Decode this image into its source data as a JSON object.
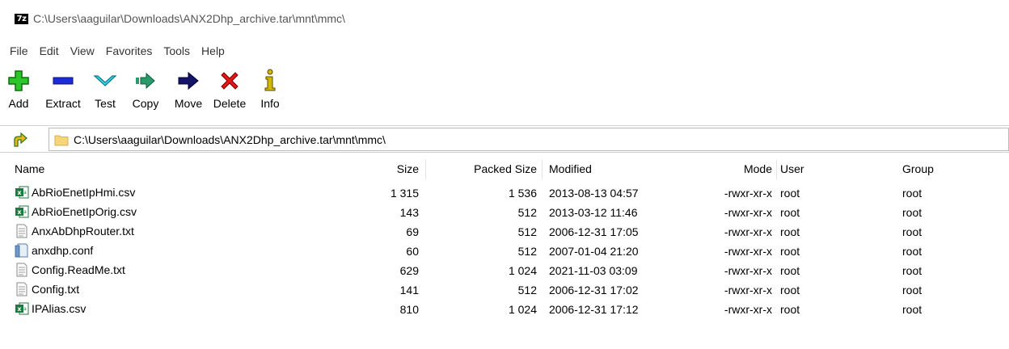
{
  "window": {
    "title": "C:\\Users\\aaguilar\\Downloads\\ANX2Dhp_archive.tar\\mnt\\mmc\\",
    "app_logo": "7z"
  },
  "menu": [
    "File",
    "Edit",
    "View",
    "Favorites",
    "Tools",
    "Help"
  ],
  "toolbar": [
    {
      "label": "Add",
      "icon": "add-icon",
      "color": "#22aa22"
    },
    {
      "label": "Extract",
      "icon": "extract-icon",
      "color": "#1c2bd6"
    },
    {
      "label": "Test",
      "icon": "test-icon",
      "color": "#22c2d6"
    },
    {
      "label": "Copy",
      "icon": "copy-icon",
      "color": "#2a9a6a"
    },
    {
      "label": "Move",
      "icon": "move-icon",
      "color": "#14146a"
    },
    {
      "label": "Delete",
      "icon": "delete-icon",
      "color": "#e01818"
    },
    {
      "label": "Info",
      "icon": "info-icon",
      "color": "#b49a00"
    }
  ],
  "address": {
    "path": "C:\\Users\\aaguilar\\Downloads\\ANX2Dhp_archive.tar\\mnt\\mmc\\"
  },
  "columns": {
    "name": "Name",
    "size": "Size",
    "packed": "Packed Size",
    "modified": "Modified",
    "mode": "Mode",
    "user": "User",
    "group": "Group"
  },
  "files": [
    {
      "name": "AbRioEnetIpHmi.csv",
      "icon": "excel-csv-icon",
      "size": "1 315",
      "packed": "1 536",
      "modified": "2013-08-13 04:57",
      "mode": "-rwxr-xr-x",
      "user": "root",
      "group": "root"
    },
    {
      "name": "AbRioEnetIpOrig.csv",
      "icon": "excel-csv-icon",
      "size": "143",
      "packed": "512",
      "modified": "2013-03-12 11:46",
      "mode": "-rwxr-xr-x",
      "user": "root",
      "group": "root"
    },
    {
      "name": "AnxAbDhpRouter.txt",
      "icon": "text-file-icon",
      "size": "69",
      "packed": "512",
      "modified": "2006-12-31 17:05",
      "mode": "-rwxr-xr-x",
      "user": "root",
      "group": "root"
    },
    {
      "name": "anxdhp.conf",
      "icon": "config-file-icon",
      "size": "60",
      "packed": "512",
      "modified": "2007-01-04 21:20",
      "mode": "-rwxr-xr-x",
      "user": "root",
      "group": "root"
    },
    {
      "name": "Config.ReadMe.txt",
      "icon": "text-file-icon",
      "size": "629",
      "packed": "1 024",
      "modified": "2021-11-03 03:09",
      "mode": "-rwxr-xr-x",
      "user": "root",
      "group": "root"
    },
    {
      "name": "Config.txt",
      "icon": "text-file-icon",
      "size": "141",
      "packed": "512",
      "modified": "2006-12-31 17:02",
      "mode": "-rwxr-xr-x",
      "user": "root",
      "group": "root"
    },
    {
      "name": "IPAlias.csv",
      "icon": "excel-csv-icon",
      "size": "810",
      "packed": "1 024",
      "modified": "2006-12-31 17:12",
      "mode": "-rwxr-xr-x",
      "user": "root",
      "group": "root"
    }
  ]
}
